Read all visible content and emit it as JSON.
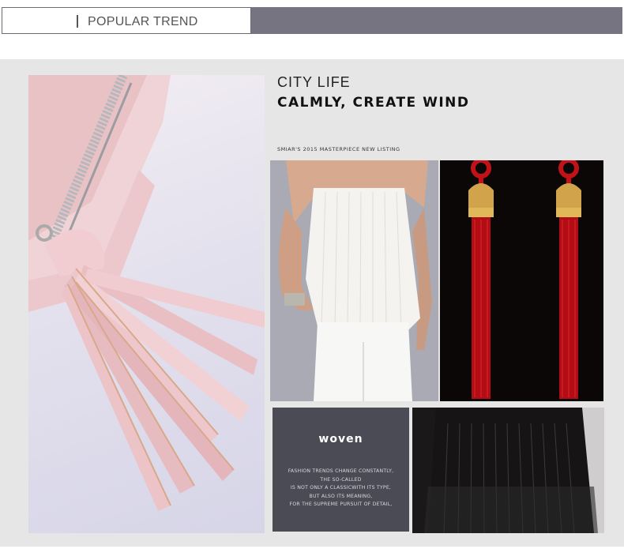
{
  "header": {
    "title": "POPULAR TREND"
  },
  "feature": {
    "title": "CITY LIFE",
    "subtitle": "CALMLY, CREATE WIND",
    "note": "SMIAR'S 2015 MASTERPIECE NEW LISTING"
  },
  "woven": {
    "title": "woven",
    "lines": [
      "FASHION TRENDS CHANGE CONSTANTLY,",
      "THE SO-CALLED",
      "IS NOT ONLY A CLASSICWITH ITS TYPE,",
      "BUT ALSO ITS MEANING,",
      "FOR THE SUPREME PURSUIT OF DETAIL,"
    ]
  },
  "colors": {
    "header_accent": "#777482",
    "panel_bg": "#e6e6e6",
    "woven_bg": "#4a4b55",
    "tassel_pink": "#e8bfc4",
    "earring_red": "#c1121a"
  }
}
